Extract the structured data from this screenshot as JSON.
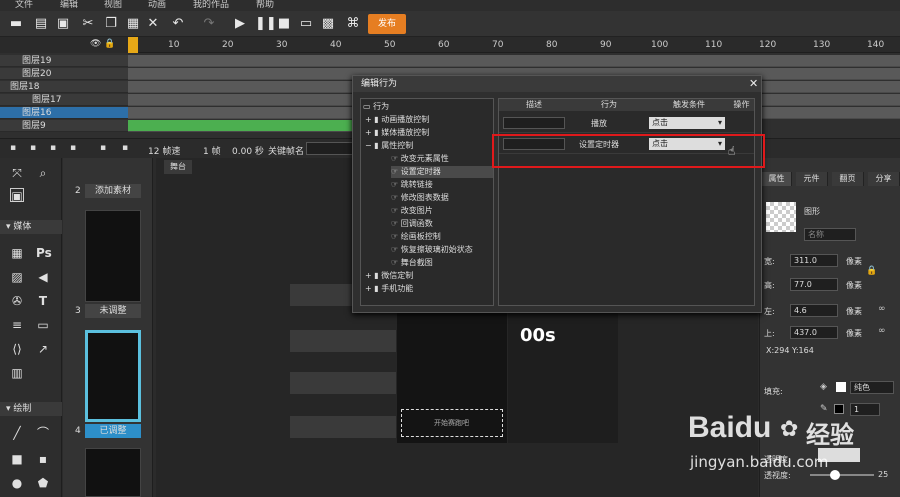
{
  "menu": [
    "文件",
    "编辑",
    "视图",
    "动画",
    "我的作品",
    "帮助"
  ],
  "toolbar": {
    "publish_label": "发布"
  },
  "timeline": {
    "ticks": [
      "10",
      "20",
      "30",
      "40",
      "50",
      "60",
      "70",
      "80",
      "90",
      "100",
      "110",
      "120",
      "130",
      "140"
    ],
    "layers": [
      "图层19",
      "图层20",
      "图层18",
      "图层17",
      "图层16",
      "图层9"
    ],
    "fps": "12 帧速",
    "frame": "1 帧",
    "time": "0.00 秒",
    "keyframe_label": "关键帧名"
  },
  "left_tools": {
    "media_label": "媒体",
    "draw_label": "绘制",
    "ps_label": "Ps",
    "text_label": "T"
  },
  "pages": {
    "p2_caption": "添加素材",
    "p3_num": "3",
    "p3_caption": "未调整",
    "p4_num": "4",
    "p4_caption": "已调整",
    "p2_num": "2"
  },
  "stage": {
    "tab": "舞台",
    "counter": "00s",
    "button_text": "开始赛跑吧"
  },
  "dialog": {
    "title": "编辑行为",
    "tree": [
      "行为",
      "动画播放控制",
      "媒体播放控制",
      "属性控制",
      "改变元素属性",
      "设置定时器",
      "跳转链接",
      "修改图表数据",
      "改变图片",
      "回调函数",
      "绘画板控制",
      "恢复擦玻璃初始状态",
      "舞台截图",
      "微信定制",
      "手机功能"
    ],
    "headers": {
      "desc": "描述",
      "behavior": "行为",
      "trigger": "触发条件",
      "action": "操作"
    },
    "rows": [
      {
        "behavior": "播放",
        "trigger": "点击"
      },
      {
        "behavior": "设置定时器",
        "trigger": "点击"
      }
    ]
  },
  "right_panel": {
    "tabs": [
      "属性",
      "元件",
      "翻页",
      "分享"
    ],
    "shape_label": "图形",
    "name_placeholder": "名称",
    "width_label": "宽:",
    "width_value": "311.0",
    "height_label": "高:",
    "height_value": "77.0",
    "left_label": "左:",
    "left_value": "4.6",
    "top_label": "上:",
    "top_value": "437.0",
    "unit": "像素",
    "coords": "X:294   Y:164",
    "fill_label": "填充:",
    "fill_mode": "纯色",
    "stroke_value": "1",
    "opacity_label": "透明度:",
    "visibility_label": "透视度:",
    "visibility_value": "25"
  },
  "watermark": {
    "brand": "Baidu",
    "cn": "经验",
    "url": "jingyan.baidu.com"
  }
}
